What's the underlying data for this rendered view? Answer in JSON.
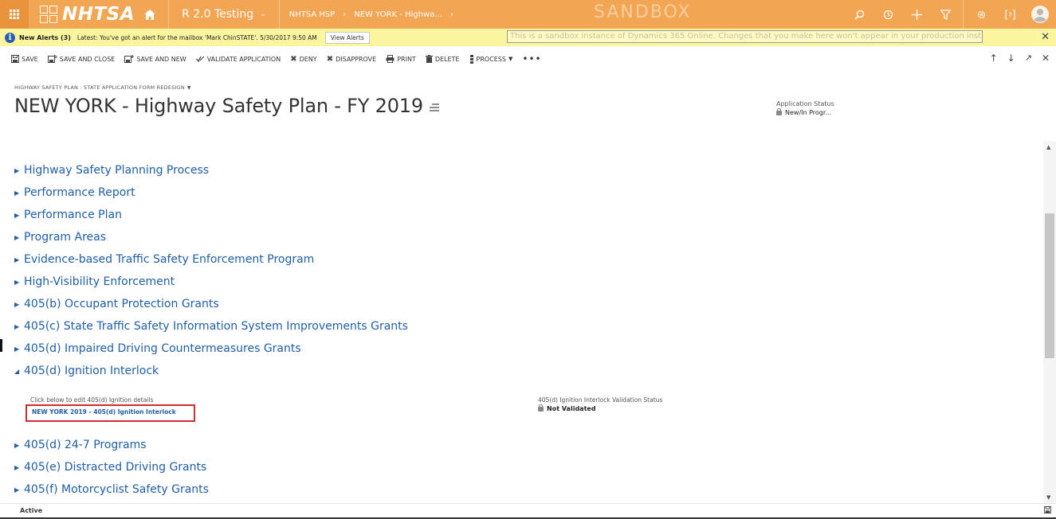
{
  "topbar": {
    "logo": "NHTSA",
    "area": "R 2.0 Testing",
    "breadcrumb_1": "NHTSA HSP",
    "breadcrumb_2": "NEW YORK - Highwa...",
    "sandbox_watermark": "SANDBOX",
    "icons": [
      "search-icon",
      "history-icon",
      "plus-icon",
      "filter-icon",
      "gear-icon",
      "help-icon",
      "user-avatar"
    ]
  },
  "alerts": {
    "title": "New Alerts (3)",
    "text": "Latest: You've got an alert for the mailbox 'Mark ChinSTATE'. 5/30/2017 9:50 AM",
    "button": "View Alerts",
    "sandbox_banner": "This is a sandbox instance of Dynamics 365 Online.  Changes that you make here won't appear in your production instance."
  },
  "commands": {
    "save": "SAVE",
    "save_close": "SAVE AND CLOSE",
    "save_new": "SAVE AND NEW",
    "validate": "VALIDATE APPLICATION",
    "deny": "DENY",
    "disapprove": "DISAPPROVE",
    "print": "PRINT",
    "delete": "DELETE",
    "process": "PROCESS",
    "more": "•••"
  },
  "header": {
    "form_selector": "HIGHWAY SAFETY PLAN : STATE APPLICATION FORM REDESIGN",
    "title": "NEW YORK - Highway Safety Plan - FY 2019",
    "status_label": "Application Status",
    "status_value": "New/In Progr..."
  },
  "sections": [
    {
      "label": "Highway Safety Planning Process"
    },
    {
      "label": "Performance Report"
    },
    {
      "label": "Performance Plan"
    },
    {
      "label": "Program Areas"
    },
    {
      "label": "Evidence-based Traffic Safety Enforcement Program"
    },
    {
      "label": "High-Visibility Enforcement"
    },
    {
      "label": "405(b) Occupant Protection Grants"
    },
    {
      "label": "405(c) State Traffic Safety Information System Improvements Grants"
    },
    {
      "label": "405(d) Impaired Driving Countermeasures Grants"
    },
    {
      "label": "405(d) Ignition Interlock"
    },
    {
      "label": "405(d) 24-7 Programs"
    },
    {
      "label": "405(e) Distracted Driving Grants"
    },
    {
      "label": "405(f) Motorcyclist Safety Grants"
    }
  ],
  "ignition": {
    "hint": "Click below to edit 405(d) Ignition details",
    "link": "NEW YORK 2019 - 405(d) Ignition Interlock",
    "status_label": "405(d) Ignition Interlock Validation Status",
    "status_value": "Not Validated"
  },
  "footer": {
    "status": "Active"
  },
  "colors": {
    "topbar": "#f2a552",
    "alert": "#fcf5a0",
    "link": "#1f5ea8",
    "highlight_box": "#d62b2b"
  }
}
